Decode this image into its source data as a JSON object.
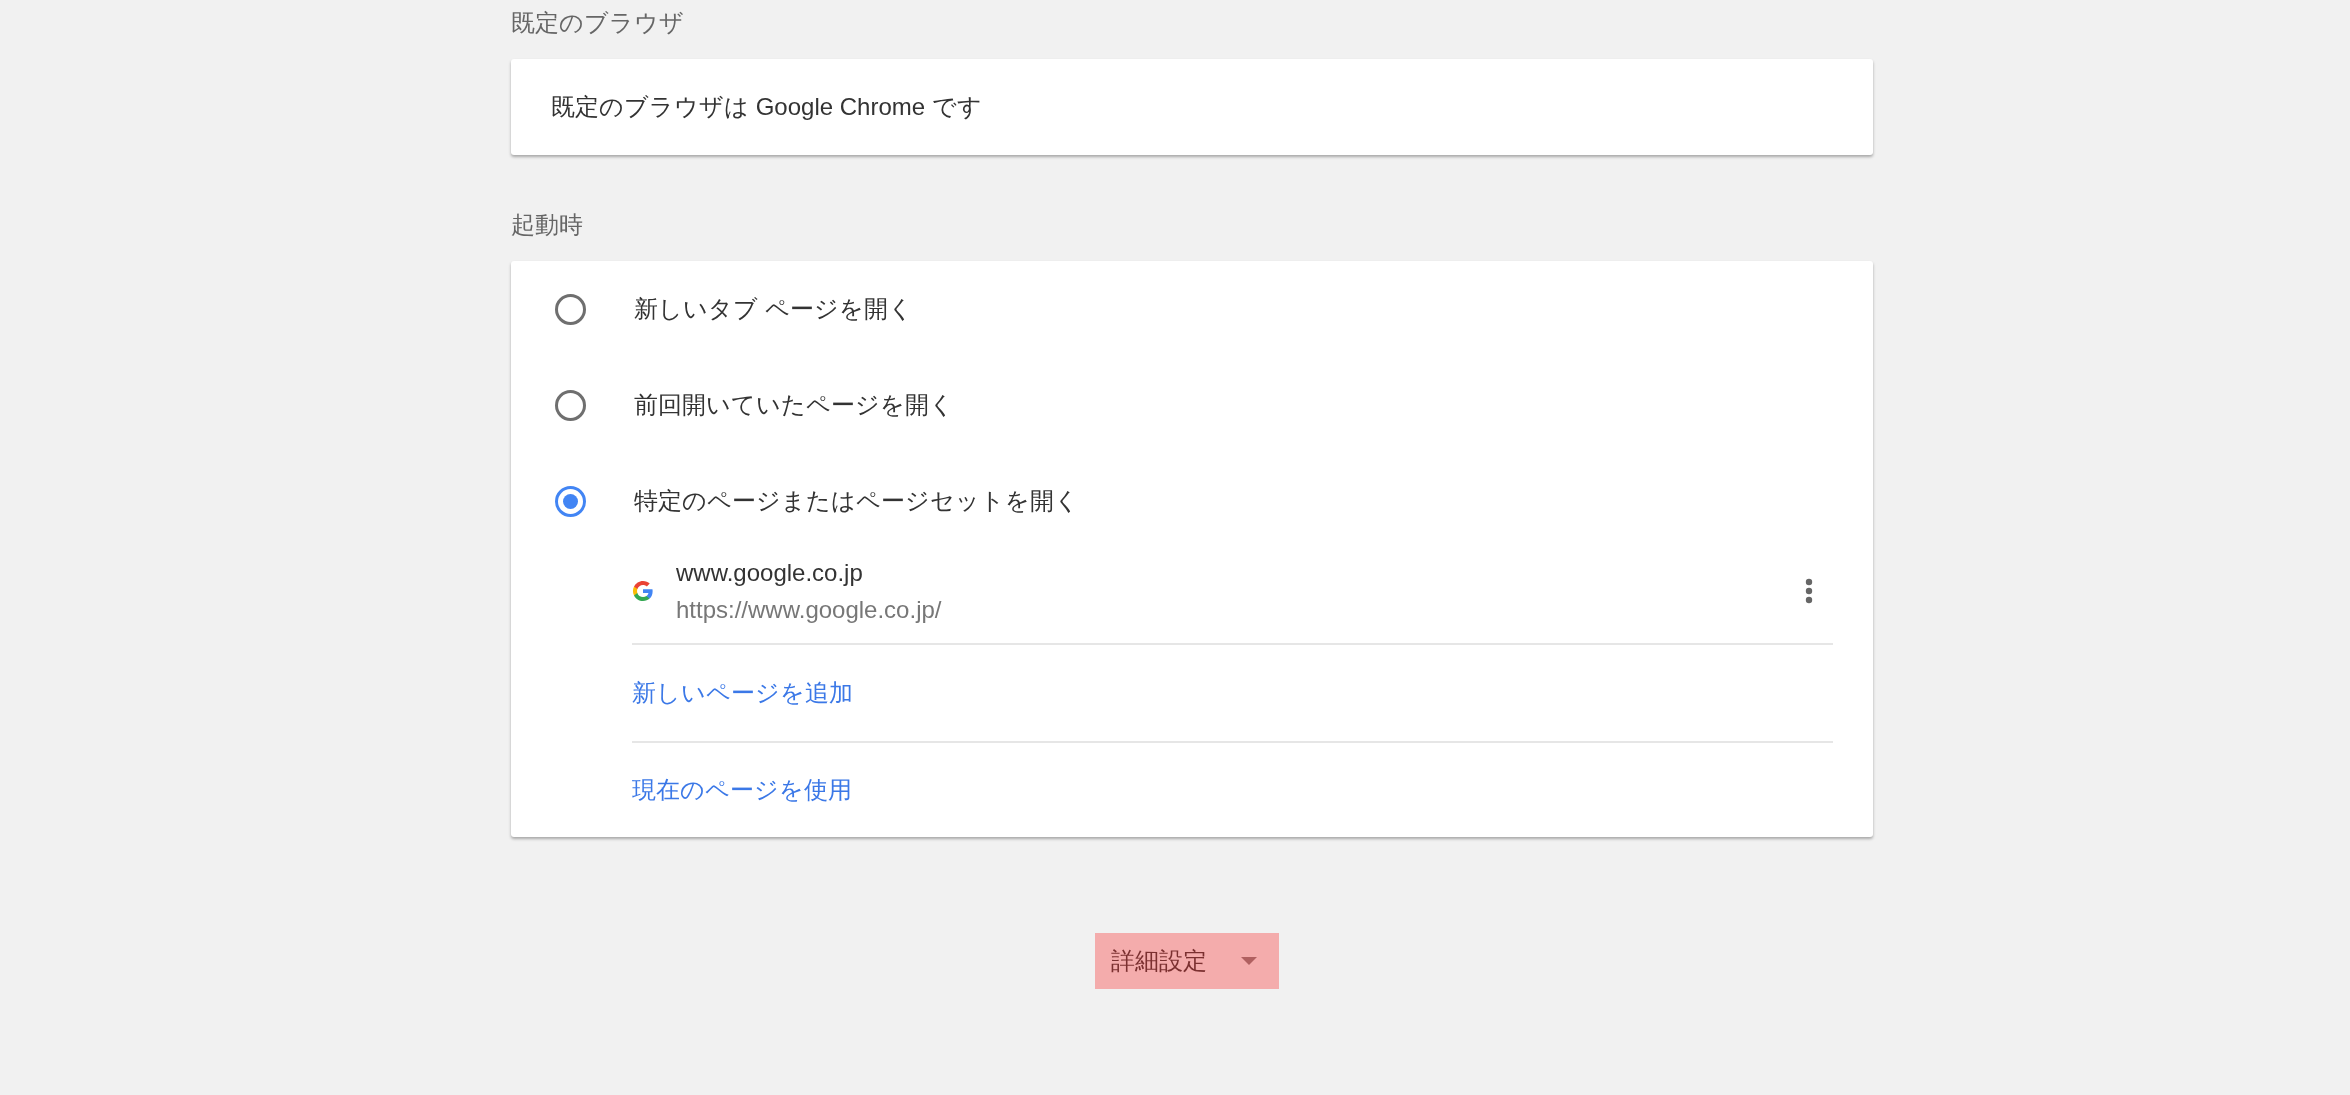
{
  "default_browser": {
    "heading": "既定のブラウザ",
    "text": "既定のブラウザは Google Chrome です"
  },
  "startup": {
    "heading": "起動時",
    "options": [
      {
        "label": "新しいタブ ページを開く",
        "selected": false
      },
      {
        "label": "前回開いていたページを開く",
        "selected": false
      },
      {
        "label": "特定のページまたはページセットを開く",
        "selected": true
      }
    ],
    "pages": [
      {
        "title": "www.google.co.jp",
        "url": "https://www.google.co.jp/"
      }
    ],
    "links": [
      "新しいページを追加",
      "現在のページを使用"
    ]
  },
  "advanced_button": {
    "label": "詳細設定"
  }
}
